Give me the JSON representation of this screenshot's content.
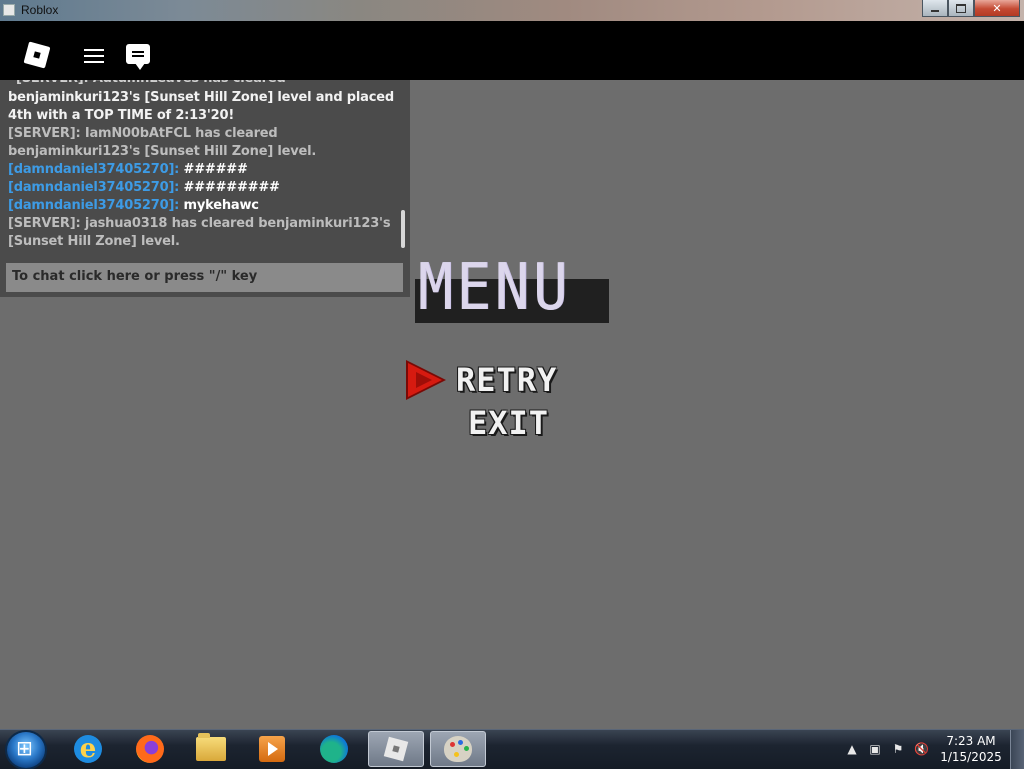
{
  "window": {
    "title": "Roblox",
    "controls": [
      "minimize",
      "maximize",
      "close"
    ]
  },
  "topbar": {
    "icons": [
      "roblox-logo-icon",
      "hamburger-menu-icon",
      "chat-bubble-icon"
    ]
  },
  "chat": {
    "cut_top": "[SERVER]: AutumnLeaves has cleared",
    "messages": [
      {
        "type": "white",
        "text": "benjaminkuri123's [Sunset Hill Zone] level and placed 4th with a TOP TIME of 2:13'20!"
      },
      {
        "type": "gray",
        "text": "[SERVER]: IamN00bAtFCL has cleared benjaminkuri123's [Sunset Hill Zone] level."
      },
      {
        "type": "user",
        "name": "[damndaniel37405270]:",
        "text": "######"
      },
      {
        "type": "user",
        "name": "[damndaniel37405270]:",
        "text": "#########"
      },
      {
        "type": "user",
        "name": "[damndaniel37405270]:",
        "text": "mykehawc"
      },
      {
        "type": "gray",
        "text": "[SERVER]: jashua0318 has cleared benjaminkuri123's [Sunset Hill Zone] level."
      }
    ],
    "input_placeholder": "To chat click here or press \"/\" key"
  },
  "menu": {
    "title": "MENU",
    "items": [
      "RETRY",
      "EXIT"
    ],
    "selected_index": 0,
    "cursor_color": "#cc1a10"
  },
  "taskbar": {
    "apps": [
      {
        "name": "internet-explorer-icon",
        "active": false
      },
      {
        "name": "firefox-icon",
        "active": false
      },
      {
        "name": "file-explorer-icon",
        "active": false
      },
      {
        "name": "media-player-icon",
        "active": false
      },
      {
        "name": "edge-icon",
        "active": false
      },
      {
        "name": "roblox-icon",
        "active": true
      },
      {
        "name": "paint-icon",
        "active": true
      }
    ],
    "clock_time": "7:23 AM",
    "clock_date": "1/15/2025"
  },
  "colors": {
    "game_background": "#6d6d6d",
    "chat_name": "#3d9be5",
    "chat_panel": "#4b4b4b"
  }
}
